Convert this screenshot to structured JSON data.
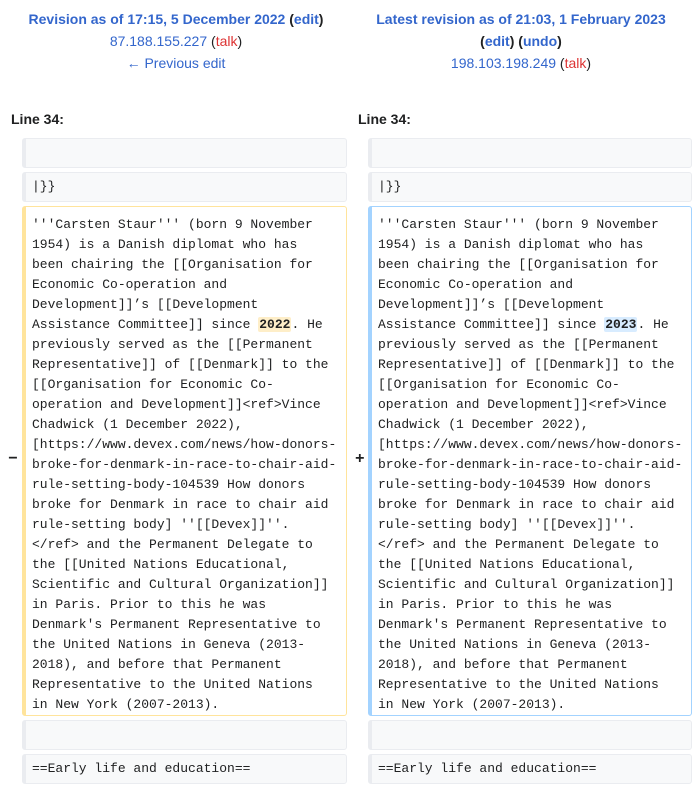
{
  "left": {
    "title": "Revision as of 17:15, 5 December 2022",
    "edit": "edit",
    "user": "87.188.155.227",
    "talk": "talk",
    "prev": "← Previous edit",
    "line": "Line 34:"
  },
  "right": {
    "title": "Latest revision as of 21:03, 1 February 2023",
    "edit": "edit",
    "undo": "undo",
    "user": "198.103.198.249",
    "talk": "talk",
    "line": "Line 34:"
  },
  "punct": {
    "open": "(",
    "close": ")",
    "sep": ") ("
  },
  "rows": {
    "context1": "",
    "context2": "|}}",
    "context3": "",
    "context4": "==Early life and education=="
  },
  "markers": {
    "minus": "−",
    "plus": "+"
  },
  "left_text": {
    "before": "'''Carsten Staur''' (born 9 November\n1954) is a Danish diplomat who has\nbeen chairing the [[Organisation for\nEconomic Co-operation and\nDevelopment]]’s [[Development\nAssistance Committee]] since ",
    "changed": "2022",
    "after": ". He\npreviously served as the [[Permanent\nRepresentative]] of [[Denmark]] to the\n[[Organisation for Economic Co-\noperation and Development]]<ref>Vince\nChadwick (1 December 2022),\n[https://www.devex.com/news/how-donors-\nbroke-for-denmark-in-race-to-chair-aid-\nrule-setting-body-104539 How donors\nbroke for Denmark in race to chair aid\nrule-setting body] ''[[Devex]]''.\n</ref> and the Permanent Delegate to\nthe [[United Nations Educational,\nScientific and Cultural Organization]]\nin Paris. Prior to this he was\nDenmark's Permanent Representative to\nthe United Nations in Geneva (2013-\n2018), and before that Permanent\nRepresentative to the United Nations\nin New York (2007-2013)."
  },
  "right_text": {
    "before": "'''Carsten Staur''' (born 9 November\n1954) is a Danish diplomat who has\nbeen chairing the [[Organisation for\nEconomic Co-operation and\nDevelopment]]’s [[Development\nAssistance Committee]] since ",
    "changed": "2023",
    "after": ". He\npreviously served as the [[Permanent\nRepresentative]] of [[Denmark]] to the\n[[Organisation for Economic Co-\noperation and Development]]<ref>Vince\nChadwick (1 December 2022),\n[https://www.devex.com/news/how-donors-\nbroke-for-denmark-in-race-to-chair-aid-\nrule-setting-body-104539 How donors\nbroke for Denmark in race to chair aid\nrule-setting body] ''[[Devex]]''.\n</ref> and the Permanent Delegate to\nthe [[United Nations Educational,\nScientific and Cultural Organization]]\nin Paris. Prior to this he was\nDenmark's Permanent Representative to\nthe United Nations in Geneva (2013-\n2018), and before that Permanent\nRepresentative to the United Nations\nin New York (2007-2013)."
  },
  "colors": {
    "link": "#3366cc",
    "talk_link": "#dd3333",
    "deleted_border": "#ffe49c",
    "added_border": "#a3d3ff",
    "deleted_highlight": "#feeec8",
    "added_highlight": "#d8ecff",
    "context_background": "#f8f9fa"
  }
}
